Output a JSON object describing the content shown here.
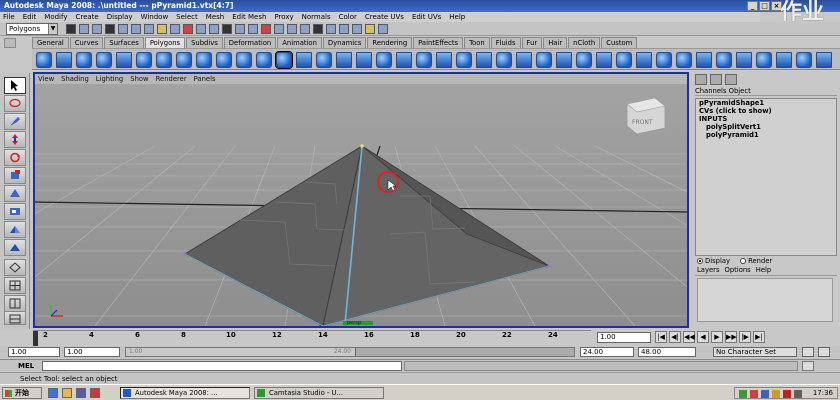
{
  "window": {
    "title": "Autodesk Maya 2008: .\\untitled   ---   pPyramid1.vtx[4:7]",
    "min": "_",
    "max": "□",
    "close": "×",
    "watermark": "作业"
  },
  "menubar": [
    "File",
    "Edit",
    "Modify",
    "Create",
    "Display",
    "Window",
    "Select",
    "Mesh",
    "Edit Mesh",
    "Proxy",
    "Normals",
    "Color",
    "Create UVs",
    "Edit UVs",
    "Help"
  ],
  "status_line": {
    "mode": "Polygons"
  },
  "shelf": {
    "tabs": [
      "General",
      "Curves",
      "Surfaces",
      "Polygons",
      "Subdivs",
      "Deformation",
      "Animation",
      "Dynamics",
      "Rendering",
      "PaintEffects",
      "Toon",
      "Fluids",
      "Fur",
      "Hair",
      "nCloth",
      "Custom"
    ],
    "active_tab": "Polygons"
  },
  "viewport": {
    "menu": [
      "View",
      "Shading",
      "Lighting",
      "Show",
      "Renderer",
      "Panels"
    ],
    "view_cube_label": "FRONT",
    "selection_label": "persp"
  },
  "channel_box": {
    "header": [
      "Channels",
      "Object"
    ],
    "shape": "pPyramidShape1",
    "cvs_label": "CVs (click to show)",
    "inputs_label": "INPUTS",
    "inputs": [
      "polySplitVert1",
      "polyPyramid1"
    ]
  },
  "layer_editor": {
    "display_label": "Display",
    "render_label": "Render",
    "menu": [
      "Layers",
      "Options",
      "Help"
    ],
    "selected_mode": "Display"
  },
  "time_slider": {
    "ticks": [
      "2",
      "4",
      "6",
      "8",
      "10",
      "12",
      "14",
      "16",
      "18",
      "20",
      "22",
      "24"
    ],
    "current_time": "1.00",
    "playback_buttons": [
      "|◀",
      "◀|",
      "◀◀",
      "◀",
      "▶",
      "▶▶",
      "|▶",
      "▶|"
    ]
  },
  "range_slider": {
    "start_time": "1.00",
    "start_range": "1.00",
    "range_left_label": "1.00",
    "range_right_label": "24.00",
    "end_range": "24.00",
    "end_time": "48.00",
    "character_set": "No Character Set"
  },
  "command_line": {
    "label": "MEL"
  },
  "help_line": {
    "text": "Select Tool: select an object"
  },
  "taskbar": {
    "start": "开始",
    "tasks": [
      "Autodesk Maya 2008: ...",
      "Camtasia Studio - U..."
    ],
    "clock": "17:36"
  }
}
